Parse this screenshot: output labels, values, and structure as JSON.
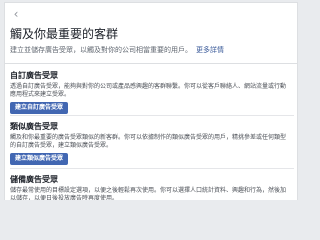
{
  "header": {
    "back_icon": "chevron-left-icon",
    "title": "觸及你最重要的客群",
    "subtitle": "建立並儲存廣告受眾，以觸及對你的公司相當重要的用戶。",
    "more_link": "更多詳情"
  },
  "sections": [
    {
      "title": "自訂廣告受眾",
      "description": "透過自訂廣告受眾，能夠與對你的公司或產品感興趣的客群聯繫。你可以從客戶聯絡人、網站流量或行動應用程式來建立受眾。",
      "button_label": "建立自訂廣告受眾"
    },
    {
      "title": "類似廣告受眾",
      "description": "觸及和你最重要的廣告受眾類似的新客群。你可以依據制作的類似廣告受眾的用戶，精挑參差或任何類型的自訂廣告受眾，建立類似廣告受眾。",
      "button_label": "建立類似廣告受眾"
    },
    {
      "title": "儲備廣告受眾",
      "description": "儲存最常使用的目標設定選項，以便之後輕鬆再次使用。你可以選擇人口統計資料、興趣和行為，然後加以儲存，以便日後投放廣告時再度使用。"
    }
  ]
}
